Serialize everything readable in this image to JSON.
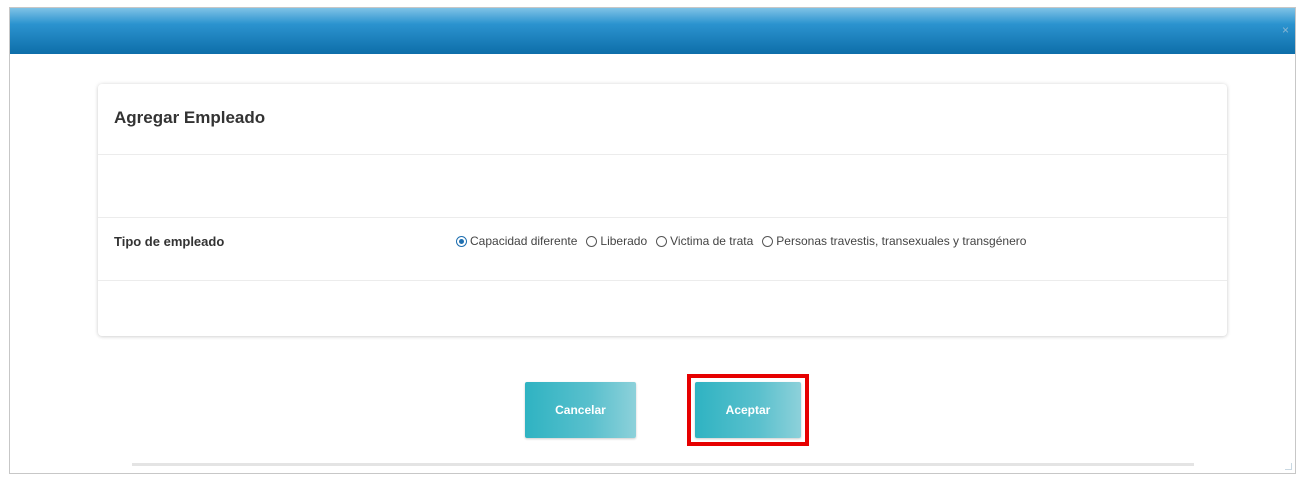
{
  "dialog": {
    "close_glyph": "×"
  },
  "card": {
    "title": "Agregar Empleado",
    "field_label": "Tipo de empleado",
    "options": [
      {
        "label": "Capacidad diferente",
        "checked": true
      },
      {
        "label": "Liberado",
        "checked": false
      },
      {
        "label": "Victima de trata",
        "checked": false
      },
      {
        "label": "Personas travestis, transexuales y transgénero",
        "checked": false
      }
    ]
  },
  "buttons": {
    "cancel_label": "Cancelar",
    "accept_label": "Aceptar"
  },
  "colors": {
    "titlebar": "#1a7ab8",
    "button": "#2fb3c2",
    "highlight": "#e60000",
    "radio_checked": "#1f6fb0"
  }
}
